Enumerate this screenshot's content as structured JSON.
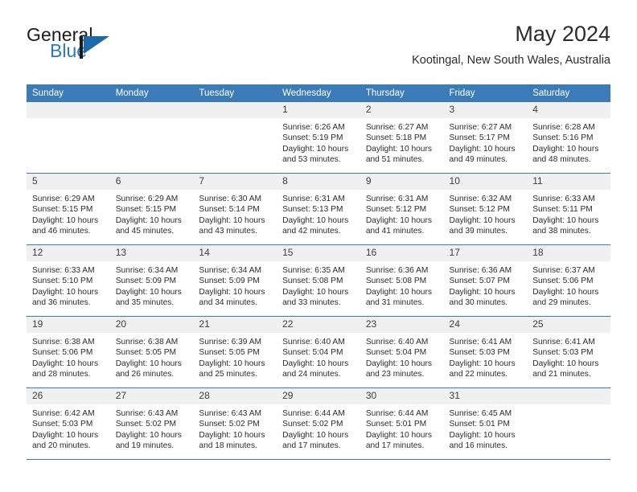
{
  "brand": {
    "name_top": "General",
    "name_bottom": "Blue",
    "accent_color": "#2a7ab9"
  },
  "header": {
    "title": "May 2024",
    "subtitle": "Kootingal, New South Wales, Australia"
  },
  "theme": {
    "header_blue": "#3b7cb8",
    "daynum_gray": "#f0f0f0",
    "text": "#2b2b2b"
  },
  "weekdays": [
    "Sunday",
    "Monday",
    "Tuesday",
    "Wednesday",
    "Thursday",
    "Friday",
    "Saturday"
  ],
  "labels": {
    "sunrise": "Sunrise:",
    "sunset": "Sunset:",
    "daylight": "Daylight:"
  },
  "weeks": [
    [
      {
        "day": "",
        "empty": true
      },
      {
        "day": "",
        "empty": true
      },
      {
        "day": "",
        "empty": true
      },
      {
        "day": "1",
        "sunrise": "Sunrise: 6:26 AM",
        "sunset": "Sunset: 5:19 PM",
        "daylight_line1": "Daylight: 10 hours",
        "daylight_line2": "and 53 minutes."
      },
      {
        "day": "2",
        "sunrise": "Sunrise: 6:27 AM",
        "sunset": "Sunset: 5:18 PM",
        "daylight_line1": "Daylight: 10 hours",
        "daylight_line2": "and 51 minutes."
      },
      {
        "day": "3",
        "sunrise": "Sunrise: 6:27 AM",
        "sunset": "Sunset: 5:17 PM",
        "daylight_line1": "Daylight: 10 hours",
        "daylight_line2": "and 49 minutes."
      },
      {
        "day": "4",
        "sunrise": "Sunrise: 6:28 AM",
        "sunset": "Sunset: 5:16 PM",
        "daylight_line1": "Daylight: 10 hours",
        "daylight_line2": "and 48 minutes."
      }
    ],
    [
      {
        "day": "5",
        "sunrise": "Sunrise: 6:29 AM",
        "sunset": "Sunset: 5:15 PM",
        "daylight_line1": "Daylight: 10 hours",
        "daylight_line2": "and 46 minutes."
      },
      {
        "day": "6",
        "sunrise": "Sunrise: 6:29 AM",
        "sunset": "Sunset: 5:15 PM",
        "daylight_line1": "Daylight: 10 hours",
        "daylight_line2": "and 45 minutes."
      },
      {
        "day": "7",
        "sunrise": "Sunrise: 6:30 AM",
        "sunset": "Sunset: 5:14 PM",
        "daylight_line1": "Daylight: 10 hours",
        "daylight_line2": "and 43 minutes."
      },
      {
        "day": "8",
        "sunrise": "Sunrise: 6:31 AM",
        "sunset": "Sunset: 5:13 PM",
        "daylight_line1": "Daylight: 10 hours",
        "daylight_line2": "and 42 minutes."
      },
      {
        "day": "9",
        "sunrise": "Sunrise: 6:31 AM",
        "sunset": "Sunset: 5:12 PM",
        "daylight_line1": "Daylight: 10 hours",
        "daylight_line2": "and 41 minutes."
      },
      {
        "day": "10",
        "sunrise": "Sunrise: 6:32 AM",
        "sunset": "Sunset: 5:12 PM",
        "daylight_line1": "Daylight: 10 hours",
        "daylight_line2": "and 39 minutes."
      },
      {
        "day": "11",
        "sunrise": "Sunrise: 6:33 AM",
        "sunset": "Sunset: 5:11 PM",
        "daylight_line1": "Daylight: 10 hours",
        "daylight_line2": "and 38 minutes."
      }
    ],
    [
      {
        "day": "12",
        "sunrise": "Sunrise: 6:33 AM",
        "sunset": "Sunset: 5:10 PM",
        "daylight_line1": "Daylight: 10 hours",
        "daylight_line2": "and 36 minutes."
      },
      {
        "day": "13",
        "sunrise": "Sunrise: 6:34 AM",
        "sunset": "Sunset: 5:09 PM",
        "daylight_line1": "Daylight: 10 hours",
        "daylight_line2": "and 35 minutes."
      },
      {
        "day": "14",
        "sunrise": "Sunrise: 6:34 AM",
        "sunset": "Sunset: 5:09 PM",
        "daylight_line1": "Daylight: 10 hours",
        "daylight_line2": "and 34 minutes."
      },
      {
        "day": "15",
        "sunrise": "Sunrise: 6:35 AM",
        "sunset": "Sunset: 5:08 PM",
        "daylight_line1": "Daylight: 10 hours",
        "daylight_line2": "and 33 minutes."
      },
      {
        "day": "16",
        "sunrise": "Sunrise: 6:36 AM",
        "sunset": "Sunset: 5:08 PM",
        "daylight_line1": "Daylight: 10 hours",
        "daylight_line2": "and 31 minutes."
      },
      {
        "day": "17",
        "sunrise": "Sunrise: 6:36 AM",
        "sunset": "Sunset: 5:07 PM",
        "daylight_line1": "Daylight: 10 hours",
        "daylight_line2": "and 30 minutes."
      },
      {
        "day": "18",
        "sunrise": "Sunrise: 6:37 AM",
        "sunset": "Sunset: 5:06 PM",
        "daylight_line1": "Daylight: 10 hours",
        "daylight_line2": "and 29 minutes."
      }
    ],
    [
      {
        "day": "19",
        "sunrise": "Sunrise: 6:38 AM",
        "sunset": "Sunset: 5:06 PM",
        "daylight_line1": "Daylight: 10 hours",
        "daylight_line2": "and 28 minutes."
      },
      {
        "day": "20",
        "sunrise": "Sunrise: 6:38 AM",
        "sunset": "Sunset: 5:05 PM",
        "daylight_line1": "Daylight: 10 hours",
        "daylight_line2": "and 26 minutes."
      },
      {
        "day": "21",
        "sunrise": "Sunrise: 6:39 AM",
        "sunset": "Sunset: 5:05 PM",
        "daylight_line1": "Daylight: 10 hours",
        "daylight_line2": "and 25 minutes."
      },
      {
        "day": "22",
        "sunrise": "Sunrise: 6:40 AM",
        "sunset": "Sunset: 5:04 PM",
        "daylight_line1": "Daylight: 10 hours",
        "daylight_line2": "and 24 minutes."
      },
      {
        "day": "23",
        "sunrise": "Sunrise: 6:40 AM",
        "sunset": "Sunset: 5:04 PM",
        "daylight_line1": "Daylight: 10 hours",
        "daylight_line2": "and 23 minutes."
      },
      {
        "day": "24",
        "sunrise": "Sunrise: 6:41 AM",
        "sunset": "Sunset: 5:03 PM",
        "daylight_line1": "Daylight: 10 hours",
        "daylight_line2": "and 22 minutes."
      },
      {
        "day": "25",
        "sunrise": "Sunrise: 6:41 AM",
        "sunset": "Sunset: 5:03 PM",
        "daylight_line1": "Daylight: 10 hours",
        "daylight_line2": "and 21 minutes."
      }
    ],
    [
      {
        "day": "26",
        "sunrise": "Sunrise: 6:42 AM",
        "sunset": "Sunset: 5:03 PM",
        "daylight_line1": "Daylight: 10 hours",
        "daylight_line2": "and 20 minutes."
      },
      {
        "day": "27",
        "sunrise": "Sunrise: 6:43 AM",
        "sunset": "Sunset: 5:02 PM",
        "daylight_line1": "Daylight: 10 hours",
        "daylight_line2": "and 19 minutes."
      },
      {
        "day": "28",
        "sunrise": "Sunrise: 6:43 AM",
        "sunset": "Sunset: 5:02 PM",
        "daylight_line1": "Daylight: 10 hours",
        "daylight_line2": "and 18 minutes."
      },
      {
        "day": "29",
        "sunrise": "Sunrise: 6:44 AM",
        "sunset": "Sunset: 5:02 PM",
        "daylight_line1": "Daylight: 10 hours",
        "daylight_line2": "and 17 minutes."
      },
      {
        "day": "30",
        "sunrise": "Sunrise: 6:44 AM",
        "sunset": "Sunset: 5:01 PM",
        "daylight_line1": "Daylight: 10 hours",
        "daylight_line2": "and 17 minutes."
      },
      {
        "day": "31",
        "sunrise": "Sunrise: 6:45 AM",
        "sunset": "Sunset: 5:01 PM",
        "daylight_line1": "Daylight: 10 hours",
        "daylight_line2": "and 16 minutes."
      },
      {
        "day": "",
        "empty": true
      }
    ]
  ]
}
